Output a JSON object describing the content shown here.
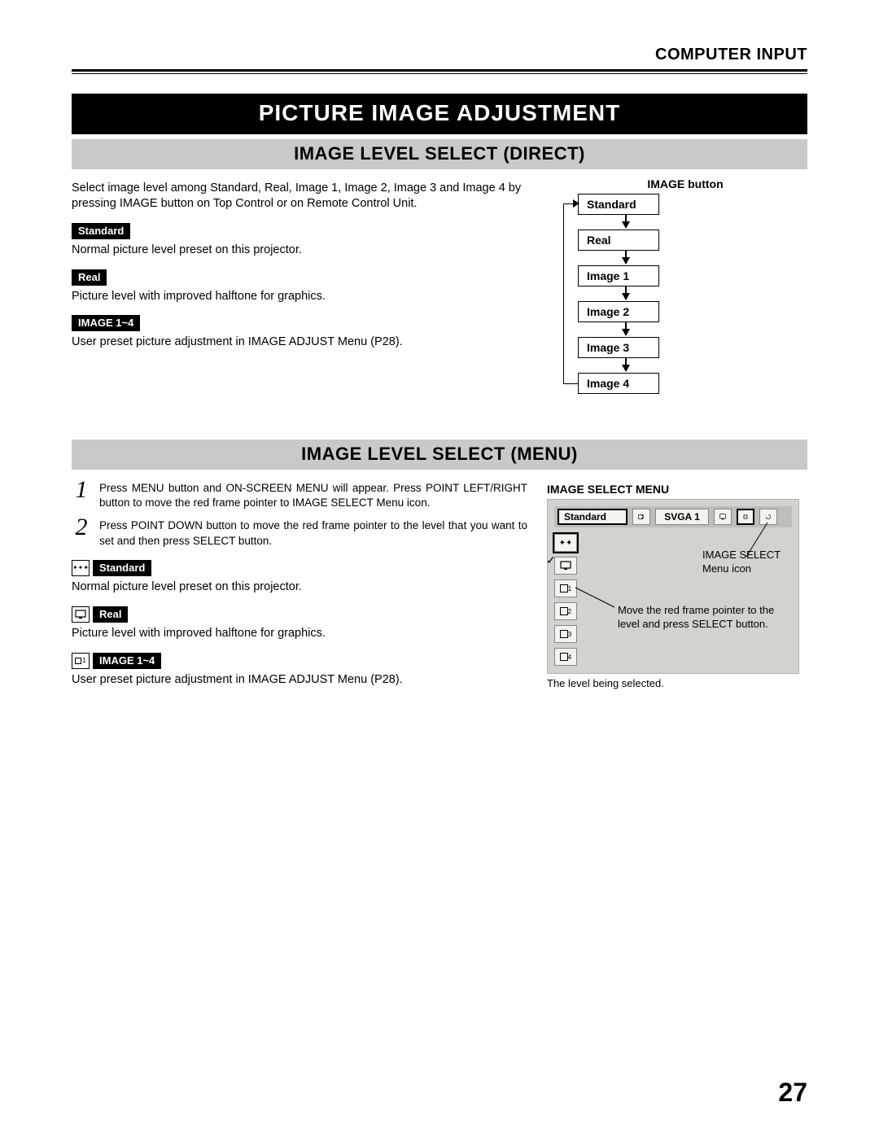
{
  "header": {
    "label": "COMPUTER INPUT"
  },
  "title": "PICTURE IMAGE ADJUSTMENT",
  "section1": {
    "heading": "IMAGE LEVEL SELECT (DIRECT)",
    "intro": "Select image level among Standard, Real, Image 1, Image 2, Image 3 and Image 4 by pressing IMAGE button on Top Control or on Remote Control Unit.",
    "defs": [
      {
        "tag": "Standard",
        "desc": "Normal picture level preset on this projector."
      },
      {
        "tag": "Real",
        "desc": "Picture level with improved halftone for graphics."
      },
      {
        "tag": "IMAGE 1~4",
        "desc": "User preset picture adjustment in IMAGE ADJUST Menu (P28)."
      }
    ],
    "diagram": {
      "title": "IMAGE button",
      "items": [
        "Standard",
        "Real",
        "Image 1",
        "Image 2",
        "Image 3",
        "Image 4"
      ]
    }
  },
  "section2": {
    "heading": "IMAGE LEVEL SELECT (MENU)",
    "steps": [
      "Press MENU button and ON-SCREEN MENU will appear.  Press POINT LEFT/RIGHT button to move the red frame pointer to IMAGE SELECT Menu icon.",
      "Press POINT DOWN button to move the red frame pointer to the level that you want to set and then press SELECT button."
    ],
    "defs": [
      {
        "tag": "Standard",
        "desc": "Normal picture level preset on this projector."
      },
      {
        "tag": "Real",
        "desc": "Picture level with improved halftone for graphics."
      },
      {
        "tag": "IMAGE 1~4",
        "desc": "User preset picture adjustment in IMAGE ADJUST Menu (P28)."
      }
    ],
    "menuShot": {
      "title": "IMAGE SELECT MENU",
      "topStrip": {
        "label": "Standard",
        "mode": "SVGA 1"
      },
      "sideLabels": [
        "◆",
        "▢",
        "1",
        "2",
        "3",
        "4"
      ],
      "note1a": "IMAGE SELECT",
      "note1b": "Menu icon",
      "note2": "Move the red frame pointer to the level and press SELECT button.",
      "caption": "The level being selected."
    }
  },
  "pageNumber": "27"
}
